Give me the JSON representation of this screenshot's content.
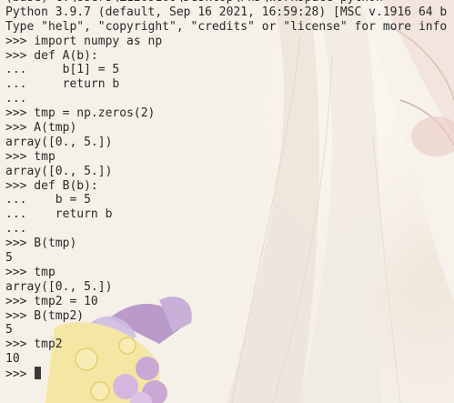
{
  "terminal": {
    "lines": [
      "(base) C:\\Users\\Z1209160\\Desktop\\PhD\\Workspace-python",
      "Python 3.9.7 (default, Sep 16 2021, 16:59:28) [MSC v.1916 64 b",
      "Type \"help\", \"copyright\", \"credits\" or \"license\" for more info",
      ">>> import numpy as np",
      ">>> def A(b):",
      "...     b[1] = 5",
      "...     return b",
      "...",
      ">>> tmp = np.zeros(2)",
      ">>> A(tmp)",
      "array([0., 5.])",
      ">>> tmp",
      "array([0., 5.])",
      ">>> def B(b):",
      "...    b = 5",
      "...    return b",
      "...",
      ">>> B(tmp)",
      "5",
      ">>> tmp",
      "array([0., 5.])",
      ">>> tmp2 = 10",
      ">>> B(tmp2)",
      "5",
      ">>> tmp2",
      "10"
    ],
    "prompt": ">>> "
  }
}
